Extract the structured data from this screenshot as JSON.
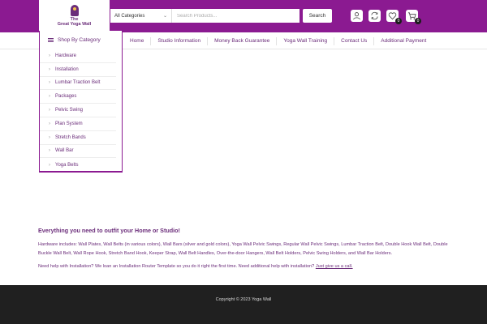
{
  "logo": {
    "line1": "The",
    "line2": "Great Yoga Wall"
  },
  "search": {
    "category": "All Categories",
    "placeholder": "Search Products...",
    "button": "Search"
  },
  "header_icons": {
    "wishlist_count": "0",
    "cart_count": "0"
  },
  "nav": {
    "shop_by_category": "Shop By Category",
    "items": [
      "Home",
      "Studio Information",
      "Money Back Guarantee",
      "Yoga Wall Training",
      "Contact Us",
      "Additional Payment"
    ]
  },
  "categories": [
    "Hardware",
    "Installation",
    "Lumbar Traction Belt",
    "Packages",
    "Pelvic Swing",
    "Plan System",
    "Stretch Bands",
    "Wall Bar",
    "Yoga Belts"
  ],
  "content": {
    "heading": "Everything you need to outfit your Home or Studio!",
    "hardware": "Hardware includes: Wall Plates, Wall Belts (in various colors), Wall Bars (silver and gold colors), Yoga Wall Pelvic Swings, Regular Wall Pelvic Swings, Lumbar Traction Belt, Double Hook Wall Belt, Double Buckle Wall Belt, Wall Rope Hook, Stretch Band Hook, Keeper Strap, Wall Belt Handles, Over-the-door Hangers, Wall Belt Holders, Pelvic Swing Holders, and Wall Bar Holders.",
    "installation_text": "Need help with Installation? We loan an Installation Router Template so you do it right the first time. Need additional help with installation?",
    "installation_link": "Just give us a call."
  },
  "footer": {
    "copyright": "Copyright © 2023 Yoga Wall"
  },
  "colors": {
    "brand": "#8b1a91",
    "text": "#6b2d7a",
    "footer": "#202020"
  }
}
